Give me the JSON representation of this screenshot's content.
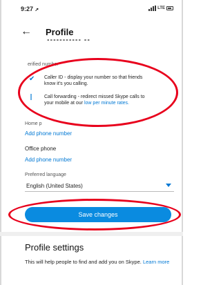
{
  "status_bar": {
    "time": "9:27",
    "carrier": "LTE"
  },
  "header": {
    "title": "Profile"
  },
  "verified_number": {
    "label": "erified number",
    "caller_id": "Caller ID - display your number so that friends know it's you calling.",
    "call_forwarding_prefix": "Call forwarding - redirect missed Skype calls to your mobile at our ",
    "call_forwarding_link": "low per minute rates."
  },
  "home_phone": {
    "label": "Home p",
    "add_link": "Add phone number"
  },
  "office_phone": {
    "label": "Office phone",
    "add_link": "Add phone number"
  },
  "language": {
    "label": "Preferred language",
    "value": "English (United States)"
  },
  "save_button": "Save changes",
  "profile_settings": {
    "title": "Profile settings",
    "desc_prefix": "This will help people to find and add you on Skype. ",
    "learn_more": "Learn more"
  },
  "colors": {
    "accent": "#0078d4",
    "button": "#0a8be0",
    "annotation": "#e8001c"
  }
}
